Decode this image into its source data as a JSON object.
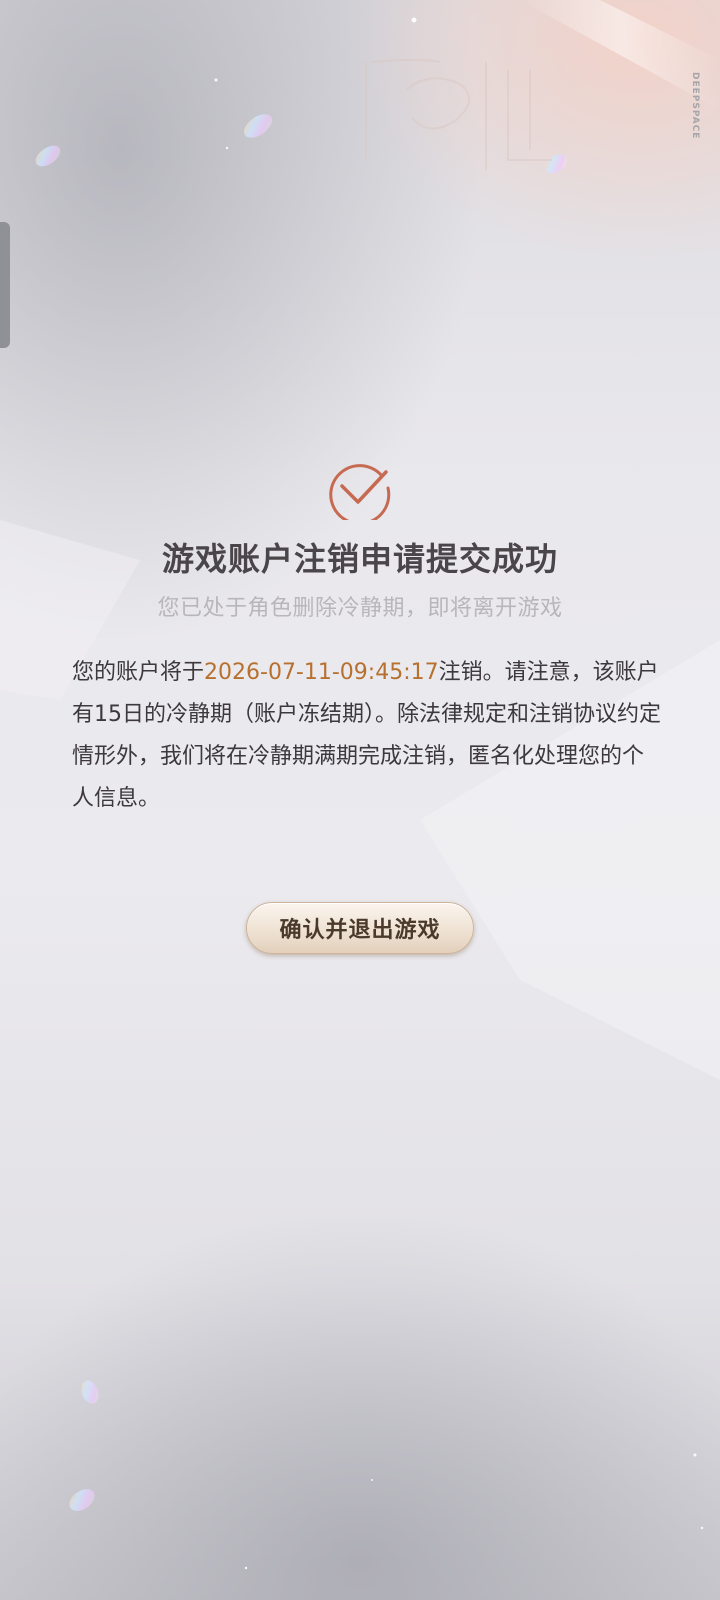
{
  "brand": {
    "logo_text": "DEEPSPACE"
  },
  "header": {
    "title": "游戏账户注销申请提交成功",
    "subtitle": "您已处于角色删除冷静期，即将离开游戏"
  },
  "notice": {
    "prefix": "您的账户将于",
    "date": "2026-07-11-09:45:17",
    "suffix": "注销。请注意，该账户有15日的冷静期（账户冻结期）。除法律规定和注销协议约定情形外，我们将在冷静期满期完成注销，匿名化处理您的个人信息。"
  },
  "actions": {
    "confirm_label": "确认并退出游戏"
  },
  "colors": {
    "accent_date": "#b8702e",
    "check_icon": "#c66a52",
    "title": "#4a4548",
    "subtitle": "#b9b6ba"
  },
  "icons": {
    "status": "check-circle-icon"
  }
}
